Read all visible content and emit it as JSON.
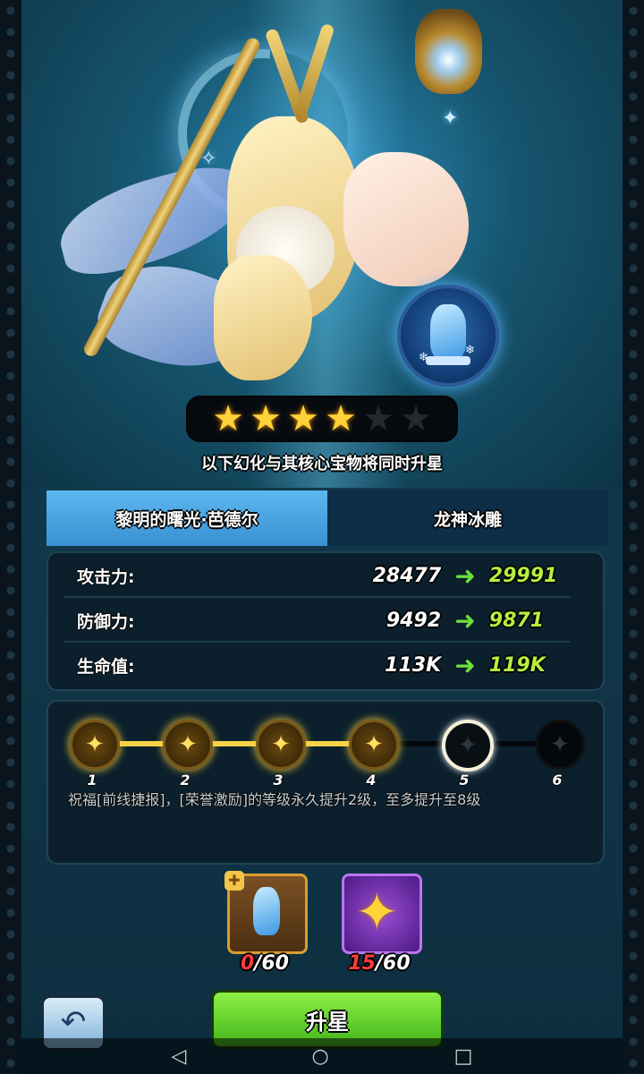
{
  "hero": {
    "stars_total": 6,
    "stars_filled": 4,
    "hint": "以下幻化与其核心宝物将同时升星"
  },
  "tabs": [
    {
      "label": "黎明的曙光·芭德尔",
      "active": true
    },
    {
      "label": "龙神冰雕",
      "active": false
    }
  ],
  "stats": [
    {
      "label": "攻击力:",
      "current": "28477",
      "next": "29991"
    },
    {
      "label": "防御力:",
      "current": "9492",
      "next": "9871"
    },
    {
      "label": "生命值:",
      "current": "113K",
      "next": "119K"
    }
  ],
  "star_track": {
    "nodes": [
      "1",
      "2",
      "3",
      "4",
      "5",
      "6"
    ],
    "filled": 4,
    "description": "祝福[前线捷报]，[荣誉激励]的等级永久提升2级，至多提升至8级"
  },
  "materials": [
    {
      "icon": "ice-statue-fragment-icon",
      "have": "0",
      "need": "/60"
    },
    {
      "icon": "gold-star-icon",
      "have": "15",
      "need": "/60"
    }
  ],
  "buttons": {
    "back_icon": "back-arrow-icon",
    "upgrade_label": "升星"
  },
  "navbar": {
    "back": "◁",
    "home": "○",
    "recent": "□"
  },
  "colors": {
    "accent_green": "#6be03c",
    "stat_new": "#b6ef3f",
    "tab_active": "#4aa3e0",
    "material_need_red": "#ff3b3b"
  }
}
